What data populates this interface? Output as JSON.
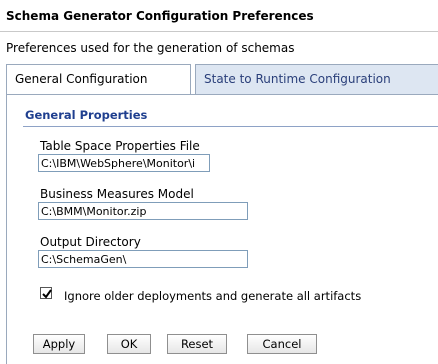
{
  "page": {
    "title": "Schema Generator Configuration Preferences",
    "description": "Preferences used for the generation of schemas"
  },
  "tabs": [
    {
      "label": "General Configuration",
      "active": true
    },
    {
      "label": "State to Runtime Configuration",
      "active": false
    }
  ],
  "section": {
    "title": "General Properties"
  },
  "fields": {
    "table_space": {
      "label": "Table Space Properties File",
      "value": "C:\\IBM\\WebSphere\\Monitor\\i"
    },
    "business_measures": {
      "label": "Business Measures Model",
      "value": "C:\\BMM\\Monitor.zip"
    },
    "output_directory": {
      "label": "Output Directory",
      "value": "C:\\SchemaGen\\"
    }
  },
  "option": {
    "label": "Ignore older deployments and generate all artifacts",
    "checked": true
  },
  "buttons": {
    "apply": "Apply",
    "ok": "OK",
    "reset": "Reset",
    "cancel": "Cancel"
  },
  "colors": {
    "section_title": "#1f3f8f",
    "inactive_tab_bg": "#dde6f2",
    "tab_border": "#9aa9bd"
  }
}
